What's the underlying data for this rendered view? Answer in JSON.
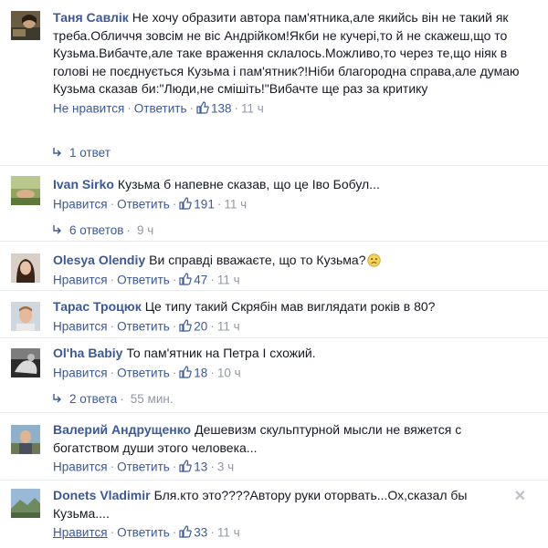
{
  "ui": {
    "separator": "·",
    "close_glyph": "✕"
  },
  "comments": [
    {
      "author": "Таня Савлік",
      "text": "Не хочу образити автора пам'ятника,але якийсь він не такий як треба.Обличчя зовсім не віс Андрійком!Якби не кучері,то й не скажеш,що то Кузьма.Вибачте,але таке враження склалось.Можливо,то через те,що ніяк в голові не поєднується Кузьма і пам'ятник?!Ніби благородна справа,але думаю Кузьма сказав би:\"Люди,не смішіть!\"Вибачте ще раз за критику",
      "like_label": "Не нравится",
      "reply_label": "Ответить",
      "likes": "138",
      "time": "11 ч",
      "replies": {
        "label": "1 ответ",
        "time": ""
      }
    },
    {
      "author": "Ivan Sirko",
      "text": "Кузьма б напевне сказав, що це Іво Бобул...",
      "like_label": "Нравится",
      "reply_label": "Ответить",
      "likes": "191",
      "time": "11 ч",
      "replies": {
        "label": "6 ответов",
        "time": "9 ч"
      }
    },
    {
      "author": "Olesya Olendiy",
      "text": "Ви справді вважаєте, що то Кузьма?",
      "like_label": "Нравится",
      "reply_label": "Ответить",
      "likes": "47",
      "time": "11 ч"
    },
    {
      "author": "Тарас Троцюк",
      "text": "Це типу такий Скрябін мав виглядати років в 80?",
      "like_label": "Нравится",
      "reply_label": "Ответить",
      "likes": "20",
      "time": "11 ч"
    },
    {
      "author": "Ol'ha Babiy",
      "text": "То пам'ятник на Петра І схожий.",
      "like_label": "Нравится",
      "reply_label": "Ответить",
      "likes": "18",
      "time": "10 ч",
      "replies": {
        "label": "2 ответа",
        "time": "55 мин."
      }
    },
    {
      "author": "Валерий Андрущенко",
      "text": "Дешевизм скульптурной мысли не вяжется с богатством души этого человека...",
      "like_label": "Нравится",
      "reply_label": "Ответить",
      "likes": "13",
      "time": "3 ч"
    },
    {
      "author": "Donets Vladimir",
      "text": "Бля.кто это????Автору руки оторвать...Ох,сказал бы Кузьма....",
      "like_label": "Нравится",
      "reply_label": "Ответить",
      "likes": "33",
      "time": "11 ч"
    }
  ]
}
